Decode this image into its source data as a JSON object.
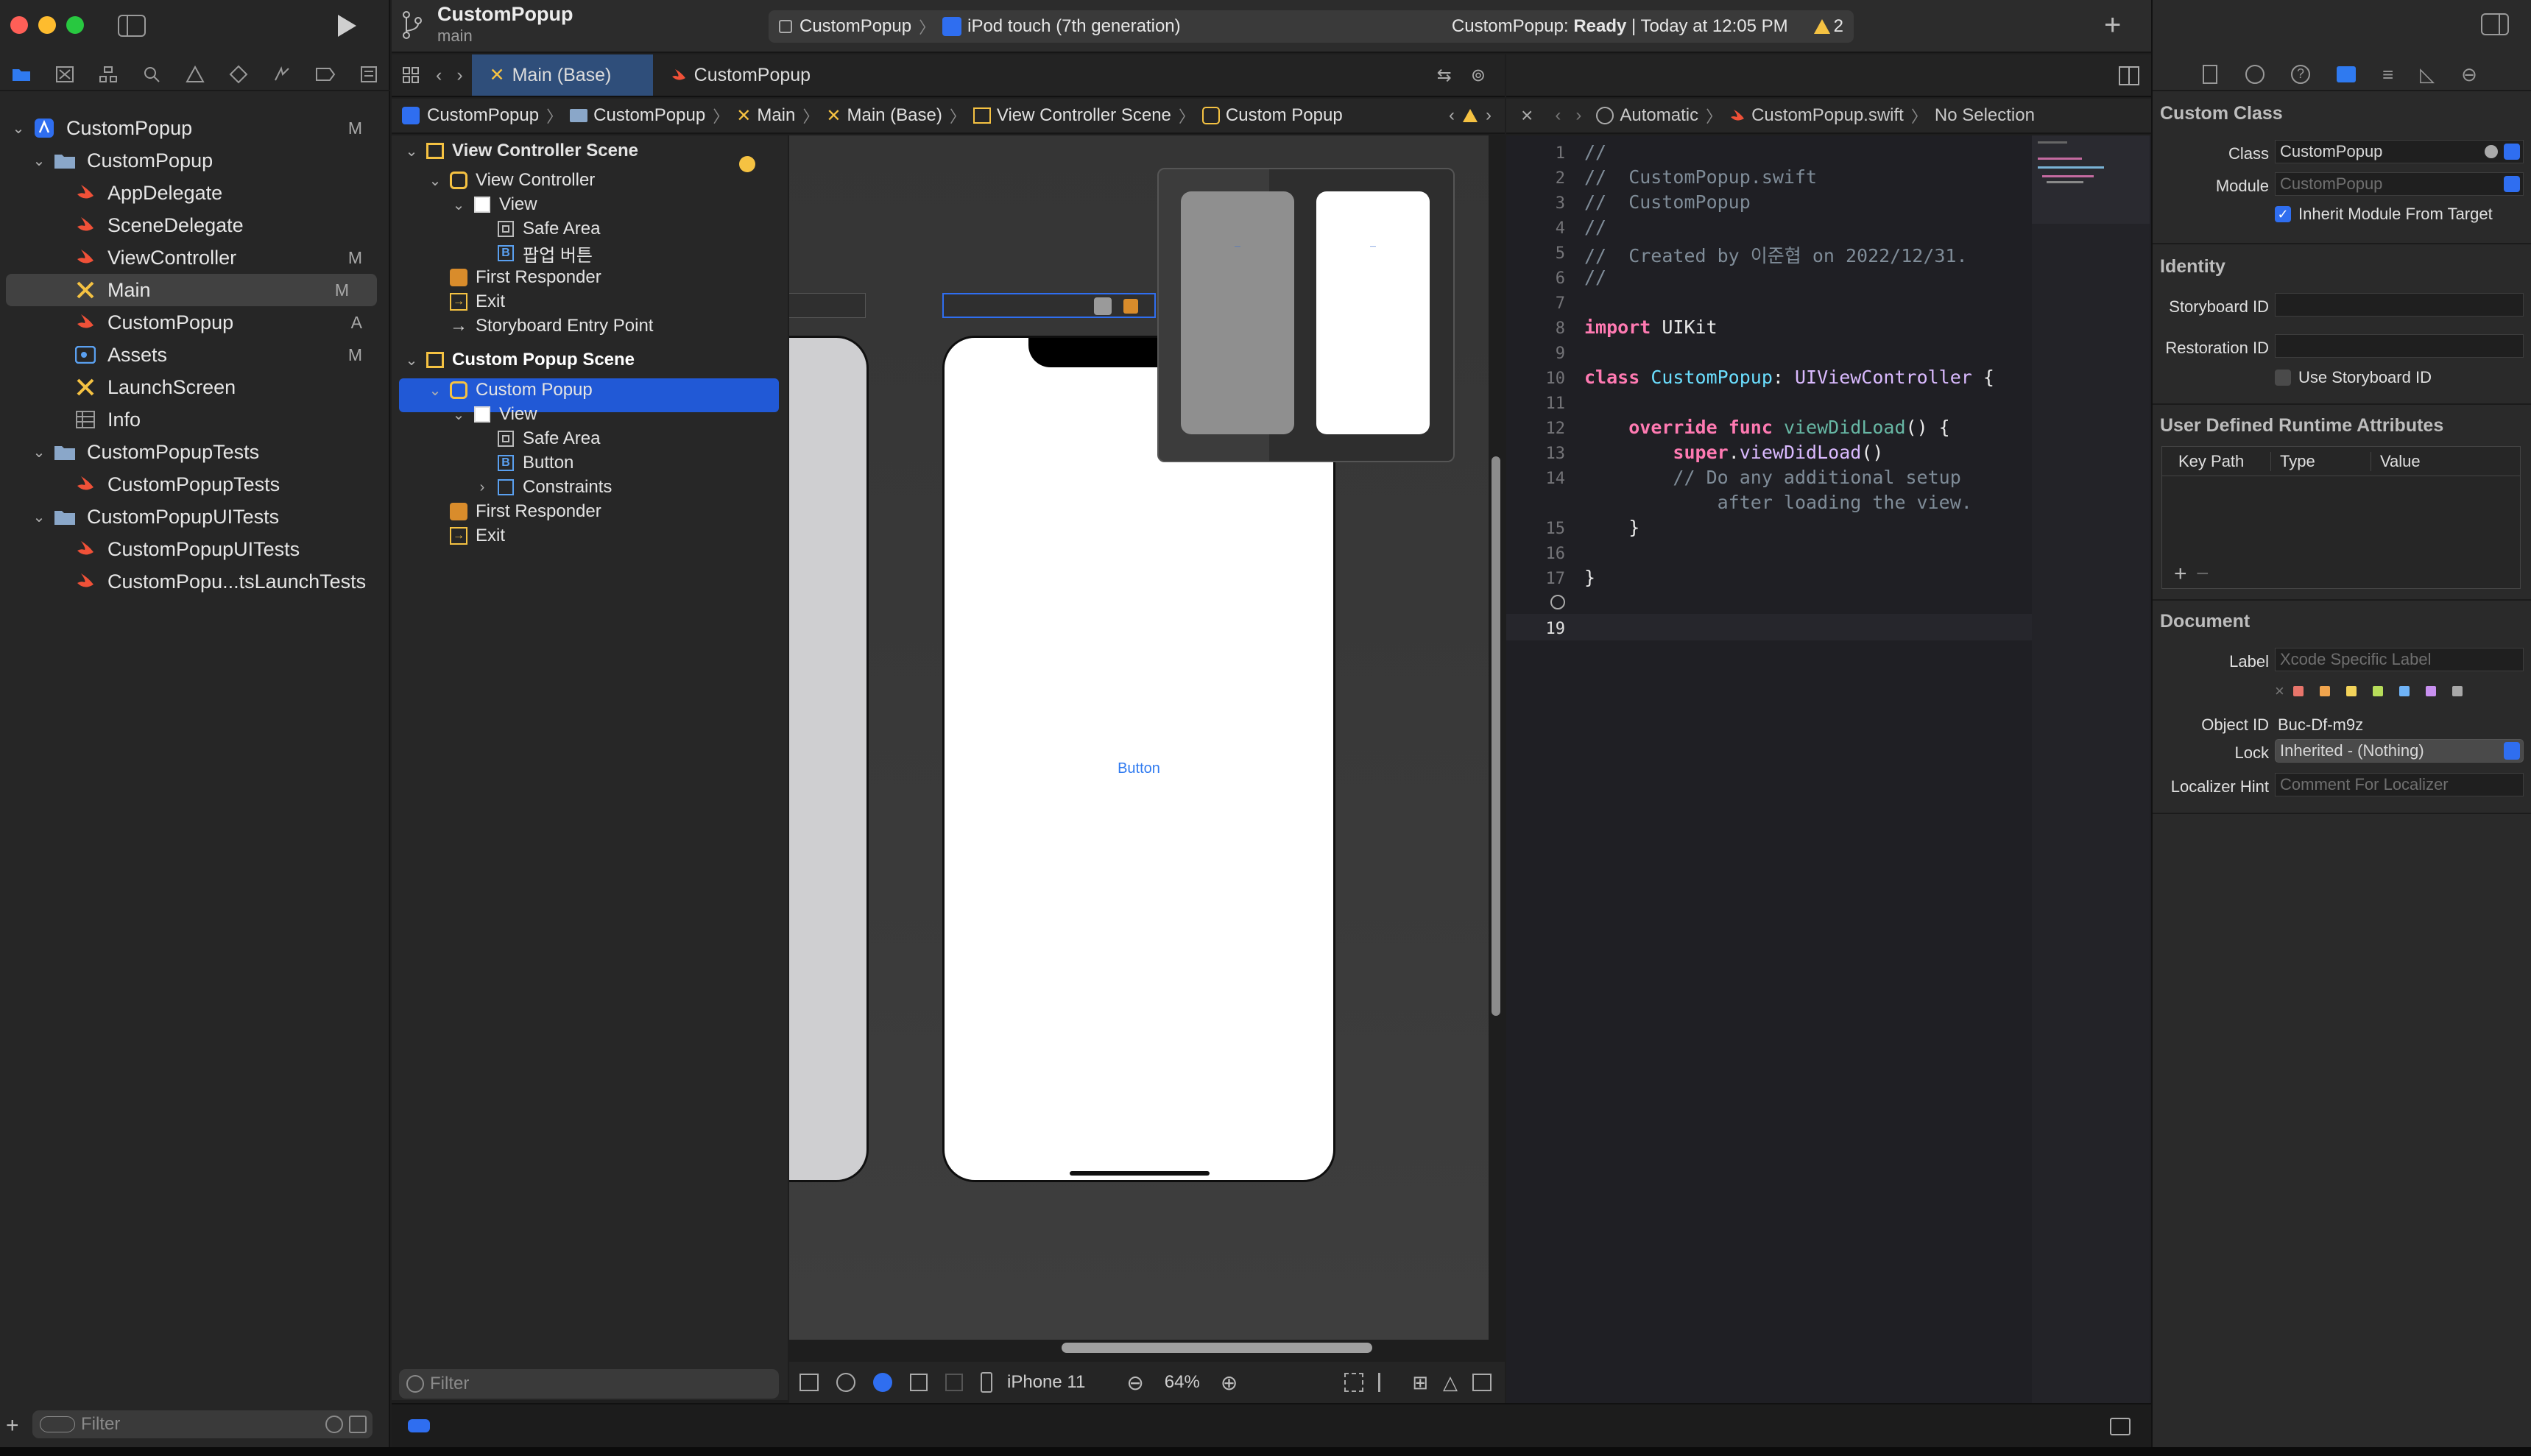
{
  "project": {
    "name": "CustomPopup",
    "branch": "main"
  },
  "toolbar": {
    "scheme": "CustomPopup",
    "device": "iPod touch (7th generation)",
    "status_prefix": "CustomPopup: ",
    "status_state": "Ready",
    "status_time": " | Today at 12:05 PM",
    "warning_count": "2"
  },
  "navigator": {
    "items": [
      {
        "label": "CustomPopup",
        "badge": "M",
        "kind": "project",
        "level": 0,
        "open": true
      },
      {
        "label": "CustomPopup",
        "badge": "",
        "kind": "folder",
        "level": 1,
        "open": true
      },
      {
        "label": "AppDelegate",
        "badge": "",
        "kind": "swift",
        "level": 2
      },
      {
        "label": "SceneDelegate",
        "badge": "",
        "kind": "swift",
        "level": 2
      },
      {
        "label": "ViewController",
        "badge": "M",
        "kind": "swift",
        "level": 2
      },
      {
        "label": "Main",
        "badge": "M",
        "kind": "storyboard",
        "level": 2,
        "selected": true
      },
      {
        "label": "CustomPopup",
        "badge": "A",
        "kind": "swift",
        "level": 2
      },
      {
        "label": "Assets",
        "badge": "M",
        "kind": "assets",
        "level": 2
      },
      {
        "label": "LaunchScreen",
        "badge": "",
        "kind": "storyboard",
        "level": 2
      },
      {
        "label": "Info",
        "badge": "",
        "kind": "plist",
        "level": 2
      },
      {
        "label": "CustomPopupTests",
        "badge": "",
        "kind": "folder",
        "level": 1,
        "open": true
      },
      {
        "label": "CustomPopupTests",
        "badge": "",
        "kind": "swift",
        "level": 2
      },
      {
        "label": "CustomPopupUITests",
        "badge": "",
        "kind": "folder",
        "level": 1,
        "open": true
      },
      {
        "label": "CustomPopupUITests",
        "badge": "",
        "kind": "swift",
        "level": 2
      },
      {
        "label": "CustomPopu...tsLaunchTests",
        "badge": "",
        "kind": "swift",
        "level": 2
      }
    ],
    "filter_placeholder": "Filter"
  },
  "editor_tabs": [
    {
      "label": "Main (Base)",
      "active": true
    },
    {
      "label": "CustomPopup",
      "active": false
    }
  ],
  "breadcrumb_left": [
    "CustomPopup",
    "CustomPopup",
    "Main",
    "Main (Base)",
    "View Controller Scene",
    "Custom Popup"
  ],
  "breadcrumb_right": [
    "Automatic",
    "CustomPopup.swift",
    "No Selection"
  ],
  "outline": {
    "items": [
      {
        "label": "View Controller Scene",
        "icon": "scene",
        "level": 0,
        "open": true,
        "bold": true
      },
      {
        "label": "View Controller",
        "icon": "vc",
        "level": 1,
        "open": true
      },
      {
        "label": "View",
        "icon": "view",
        "level": 2,
        "open": true
      },
      {
        "label": "Safe Area",
        "icon": "safe",
        "level": 3
      },
      {
        "label": "팝업 버튼",
        "icon": "button",
        "level": 3
      },
      {
        "label": "First Responder",
        "icon": "responder",
        "level": 1
      },
      {
        "label": "Exit",
        "icon": "exit",
        "level": 1
      },
      {
        "label": "Storyboard Entry Point",
        "icon": "arrow",
        "level": 1
      },
      {
        "label": "Custom Popup Scene",
        "icon": "scene",
        "level": 0,
        "open": true,
        "bold": true,
        "selected": true
      },
      {
        "label": "Custom Popup",
        "icon": "vc",
        "level": 1,
        "open": true
      },
      {
        "label": "View",
        "icon": "view",
        "level": 2,
        "open": true
      },
      {
        "label": "Safe Area",
        "icon": "safe",
        "level": 3
      },
      {
        "label": "Button",
        "icon": "button",
        "level": 3
      },
      {
        "label": "Constraints",
        "icon": "constraints",
        "level": 3,
        "collapsed": true
      },
      {
        "label": "First Responder",
        "icon": "responder",
        "level": 1
      },
      {
        "label": "Exit",
        "icon": "exit",
        "level": 1
      }
    ],
    "filter_placeholder": "Filter"
  },
  "canvas": {
    "button_label": "Button",
    "device": "iPhone 11",
    "zoom": "64%"
  },
  "code": {
    "line_numbers": [
      "1",
      "2",
      "3",
      "4",
      "5",
      "6",
      "7",
      "8",
      "9",
      "10",
      "11",
      "12",
      "13",
      "14",
      "",
      "15",
      "16",
      "17",
      "",
      "19"
    ],
    "file_comment": "//  CustomPopup.swift",
    "target_comment": "//  CustomPopup",
    "created_comment": "//  Created by 이준협 on 2022/12/31.",
    "comment_slashes": "//",
    "import_kw": "import",
    "import_name": " UIKit",
    "class_kw": "class",
    "class_name": " CustomPopup",
    "superclass": "UIViewController",
    "open_brace": " {",
    "override_kw": "override",
    "func_kw": " func",
    "method_name": " viewDidLoad",
    "method_sig": "() {",
    "super_kw": "super",
    "super_call": "viewDidLoad",
    "call_parens": "()",
    "todo_comment": "// Do any additional setup",
    "todo_comment_2": "after loading the view.",
    "close_brace": "}"
  },
  "inspector": {
    "custom_class_title": "Custom Class",
    "class_label": "Class",
    "class_value": "CustomPopup",
    "module_label": "Module",
    "module_value": "CustomPopup",
    "inherit_label": "Inherit Module From Target",
    "identity_title": "Identity",
    "storyboard_id_label": "Storyboard ID",
    "restoration_id_label": "Restoration ID",
    "use_storyboard_id_label": "Use Storyboard ID",
    "udra_title": "User Defined Runtime Attributes",
    "udra_columns": [
      "Key Path",
      "Type",
      "Value"
    ],
    "document_title": "Document",
    "label_label": "Label",
    "label_placeholder": "Xcode Specific Label",
    "object_id_label": "Object ID",
    "object_id_value": "Buc-Df-m9z",
    "lock_label": "Lock",
    "lock_value": "Inherited - (Nothing)",
    "localizer_label": "Localizer Hint",
    "localizer_placeholder": "Comment For Localizer",
    "label_colors": [
      "#e8756b",
      "#f0a44d",
      "#f3d35a",
      "#b7dd5a",
      "#6fb3f7",
      "#c890f0",
      "#a8a8a8"
    ]
  },
  "colors": {
    "accent": "#2f6ef0",
    "swift": "#f05138",
    "folder": "#8aa7c9",
    "storyboard": "#f5c242",
    "warning": "#f5c242"
  }
}
